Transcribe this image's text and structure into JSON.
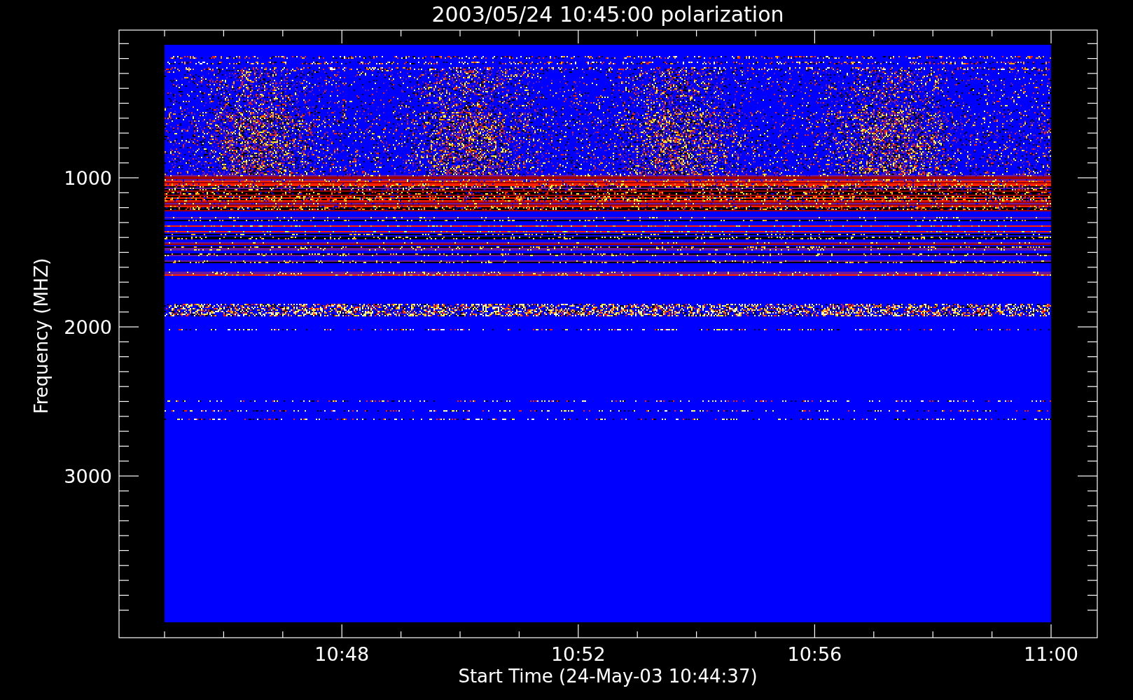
{
  "title": "2003/05/24 10:45:00 polarization",
  "x_axis": {
    "label": "Start Time (24-May-03 10:44:37)",
    "ticks": [
      "10:48",
      "10:52",
      "10:56",
      "11:00"
    ]
  },
  "y_axis": {
    "label": "Frequency (MHZ)",
    "ticks": [
      "1000",
      "2000",
      "3000"
    ]
  }
}
